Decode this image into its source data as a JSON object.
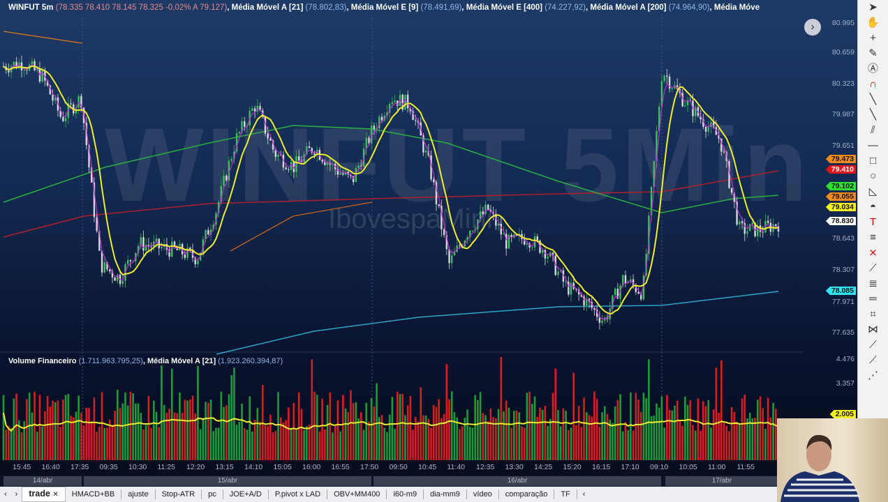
{
  "legend": {
    "symbol": "WINFUT 5m",
    "ohlc": "(78.335  78.410  78.145  78.325  -0,02%  A 79.127)",
    "ma1_name": "Média Móvel A [21]",
    "ma1_val": "(78.802,83)",
    "ma2_name": "Média Móvel E [9]",
    "ma2_val": "(78.491,69)",
    "ma3_name": "Média Móvel E [400]",
    "ma3_val": "(74.227,92)",
    "ma4_name": "Média Móvel A [200]",
    "ma4_val": "(74.964,90)",
    "ma5_name": "Média Móve"
  },
  "volume_legend": {
    "name": "Volume Financeiro",
    "val": "(1.711.963.795,25)",
    "ma_name": "Média Móvel A [21]",
    "ma_val": "(1.923.260.394,87)"
  },
  "watermark": {
    "title": "WINFUT 5Min",
    "subtitle": "IbovespaMini"
  },
  "price_axis": [
    "80.995",
    "80.659",
    "80.323",
    "79.987",
    "79.651",
    "78.643",
    "78.307",
    "77.971",
    "77.635"
  ],
  "volume_axis": [
    "4.476",
    "3.357"
  ],
  "price_tags": [
    {
      "v": "79.473",
      "c": "#f08a1c",
      "t": "#111"
    },
    {
      "v": "79.410",
      "c": "#e8141c",
      "t": "#fff"
    },
    {
      "v": "79.102",
      "c": "#2fe02f",
      "t": "#111"
    },
    {
      "v": "79.055",
      "c": "#f08a1c",
      "t": "#111"
    },
    {
      "v": "79.034",
      "c": "#f6f21c",
      "t": "#111"
    },
    {
      "v": "78.830",
      "c": "#ffffff",
      "t": "#111"
    },
    {
      "v": "78.085",
      "c": "#2fe6f0",
      "t": "#111"
    },
    {
      "v": "2.005",
      "c": "#f6f21c",
      "t": "#111"
    }
  ],
  "time_labels": [
    "15:45",
    "16:40",
    "17:35",
    "09:35",
    "10:30",
    "11:25",
    "12:20",
    "13:15",
    "14:10",
    "15:05",
    "16:00",
    "16:55",
    "17:50",
    "09:50",
    "10:45",
    "11:40",
    "12:35",
    "13:30",
    "14:25",
    "15:20",
    "16:15",
    "17:10",
    "09:10",
    "10:05",
    "11:00",
    "11:55"
  ],
  "date_labels": [
    "14/abr",
    "15/abr",
    "16/abr",
    "17/abr"
  ],
  "tabs": [
    "trade",
    "HMACD+BB",
    "ajuste",
    "Stop-ATR",
    "pc",
    "JOE+A/D",
    "P.pivot x LAD",
    "OBV+MM400",
    "i60-m9",
    "dia-mm9",
    "vídeo",
    "comparação",
    "TF"
  ],
  "chart_data": {
    "type": "candlestick",
    "close_path": [
      80.52,
      80.56,
      80.41,
      79.95,
      80.18,
      78.35,
      78.2,
      78.58,
      78.54,
      78.5,
      78.42,
      78.96,
      79.72,
      80.1,
      79.57,
      79.42,
      79.64,
      79.42,
      79.26,
      79.8,
      80.18,
      80.1,
      79.42,
      78.35,
      78.73,
      78.96,
      78.58,
      78.65,
      78.5,
      78.12,
      77.96,
      77.73,
      78.2,
      78.04,
      80.48,
      80.18,
      79.95,
      79.72,
      78.73,
      78.73,
      78.8
    ],
    "ylim": [
      77.4,
      81.05
    ]
  }
}
